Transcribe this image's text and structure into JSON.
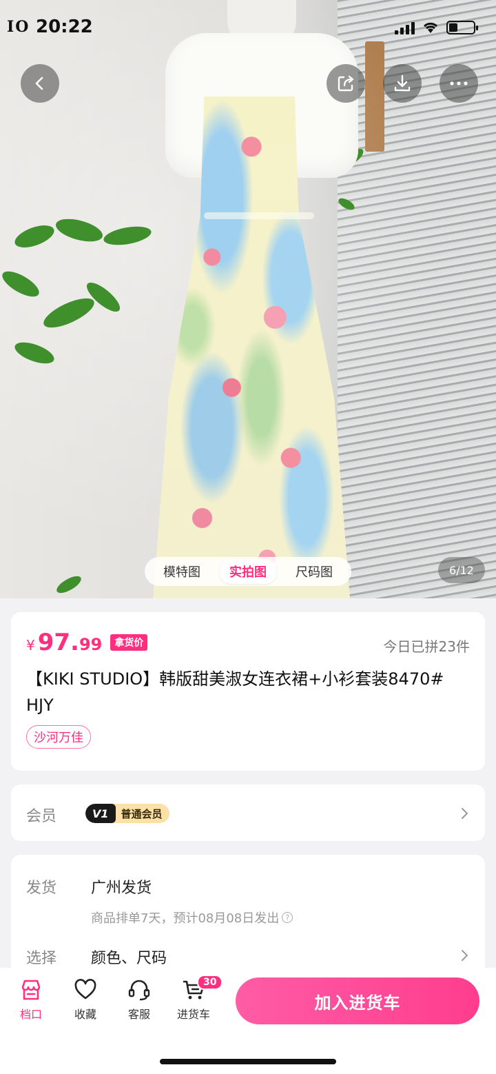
{
  "status_bar": {
    "left_text": "IO",
    "time": "20:22"
  },
  "image_viewer": {
    "tabs": [
      "模特图",
      "实拍图",
      "尺码图"
    ],
    "active_tab": 1,
    "counter": "6/12"
  },
  "price_card": {
    "currency": "¥",
    "price_int": "97.",
    "price_dec": "99",
    "price_tag": "拿货价",
    "sold_today": "今日已拼23件",
    "title": "【KIKI STUDIO】韩版甜美淑女连衣裙+小衫套装8470#  HJY",
    "market": "沙河万佳"
  },
  "member_card": {
    "label": "会员",
    "level_code": "V1",
    "level_name": "普通会员"
  },
  "shipping_card": {
    "ship_label": "发货",
    "ship_value": "广州发货",
    "ship_note": "商品排单7天，预计08月08日发出",
    "select_label": "选择",
    "select_value": "颜色、尺码"
  },
  "bottom_nav": {
    "items": [
      {
        "label": "档口",
        "icon": "store-icon"
      },
      {
        "label": "收藏",
        "icon": "heart-icon"
      },
      {
        "label": "客服",
        "icon": "headset-icon"
      },
      {
        "label": "进货车",
        "icon": "cart-icon"
      }
    ],
    "cart_count": "30",
    "cta": "加入进货车"
  },
  "colors": {
    "accent": "#ff2e7e"
  }
}
